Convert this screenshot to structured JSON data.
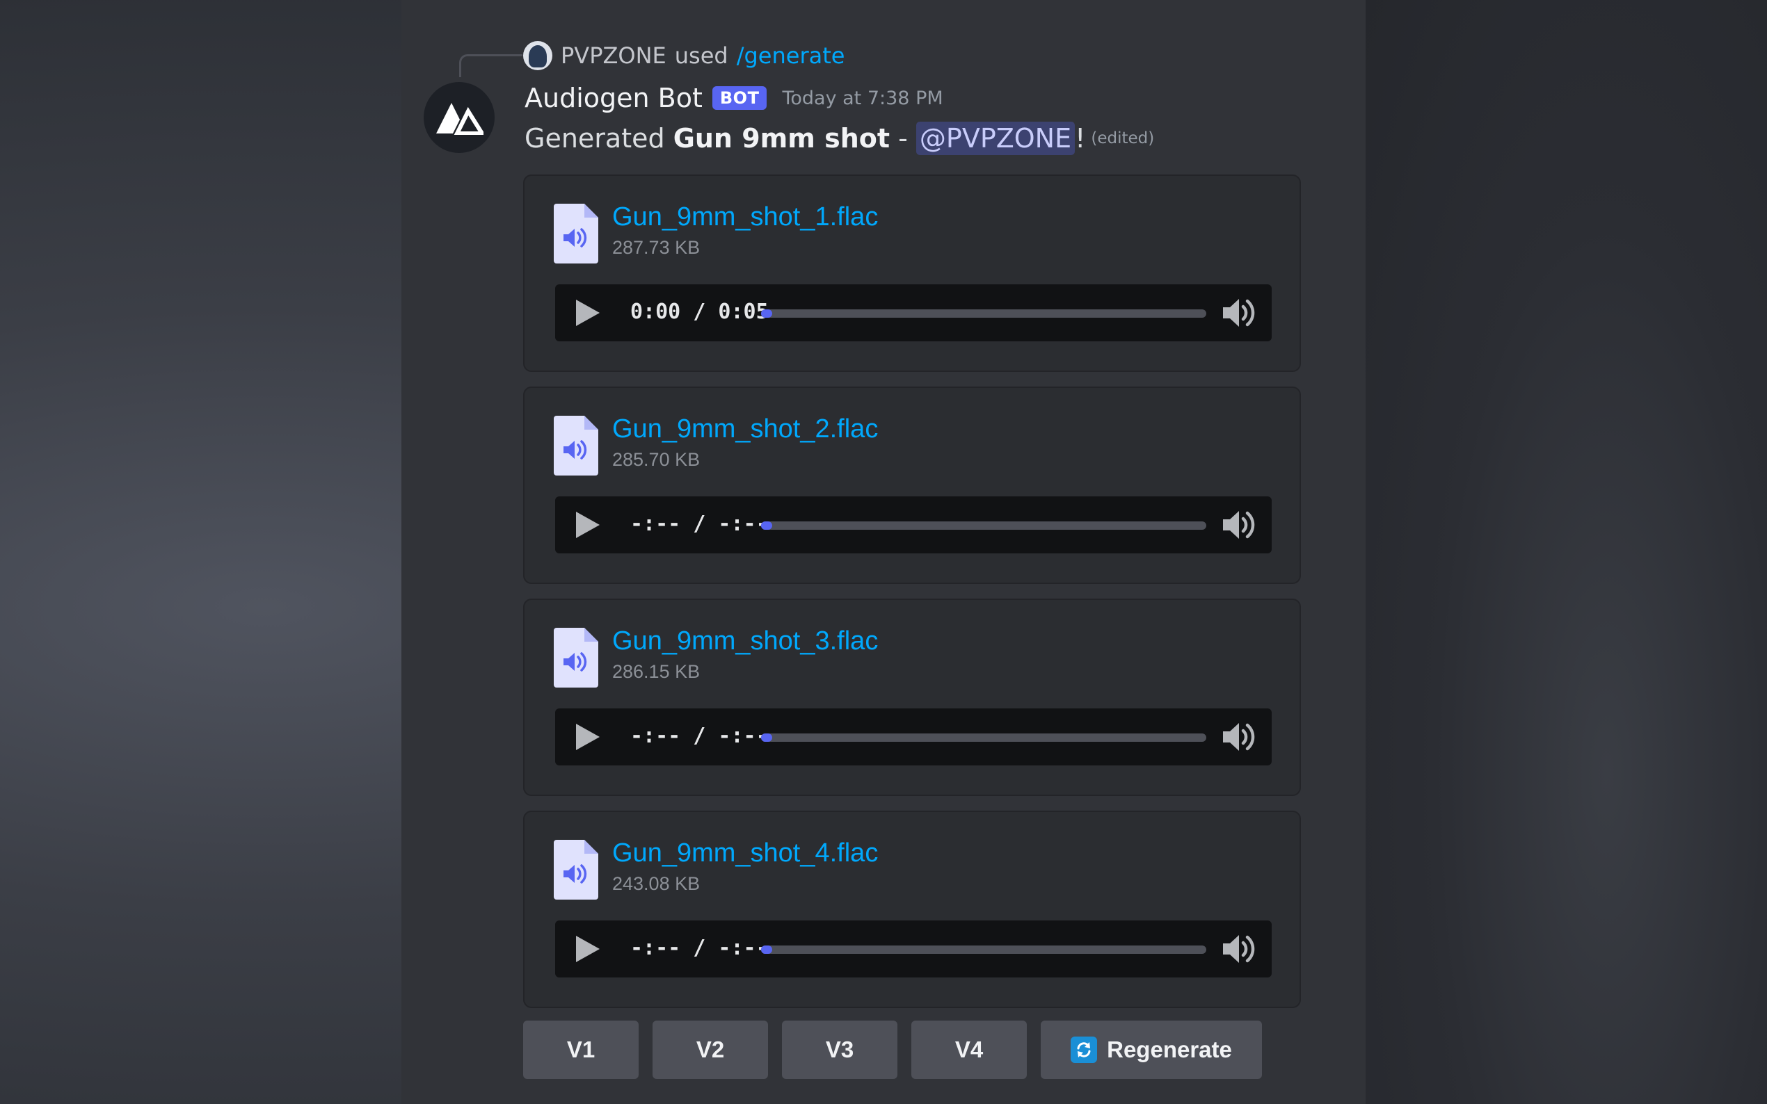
{
  "reply": {
    "username": "PVPZONE",
    "used_text": "used",
    "command": "/generate"
  },
  "message": {
    "author": "Audiogen Bot",
    "bot_tag": "BOT",
    "timestamp": "Today at 7:38 PM",
    "text_prefix": "Generated ",
    "text_bold": "Gun 9mm shot",
    "text_sep": " - ",
    "mention": "@PVPZONE",
    "text_suffix": "!",
    "edited": "(edited)"
  },
  "attachments": [
    {
      "filename": "Gun_9mm_shot_1.flac",
      "size": "287.73 KB",
      "time": "0:00 / 0:05"
    },
    {
      "filename": "Gun_9mm_shot_2.flac",
      "size": "285.70 KB",
      "time": "-:-- / -:--"
    },
    {
      "filename": "Gun_9mm_shot_3.flac",
      "size": "286.15 KB",
      "time": "-:-- / -:--"
    },
    {
      "filename": "Gun_9mm_shot_4.flac",
      "size": "243.08 KB",
      "time": "-:-- / -:--"
    }
  ],
  "buttons": {
    "v1": "V1",
    "v2": "V2",
    "v3": "V3",
    "v4": "V4",
    "regenerate": "Regenerate"
  },
  "colors": {
    "accent": "#5865f2",
    "link": "#00a8fc",
    "background": "#313338",
    "attachment_bg": "#2b2d31",
    "button_bg": "#4e5058"
  }
}
